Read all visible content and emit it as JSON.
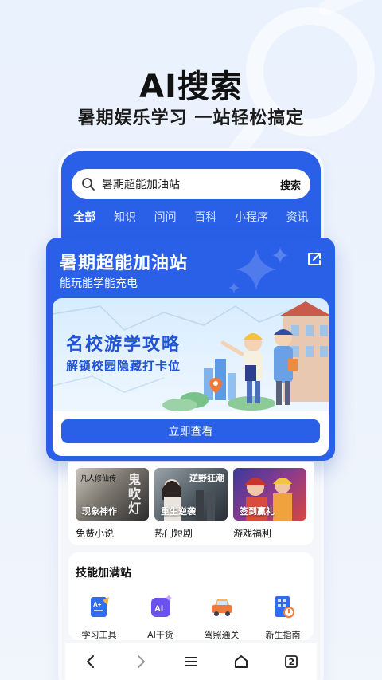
{
  "hero": {
    "title": "AI搜索",
    "subtitle": "暑期娱乐学习 一站轻松搞定"
  },
  "search": {
    "query": "暑期超能加油站",
    "button_label": "搜索",
    "icon": "search-icon"
  },
  "tabs": [
    {
      "label": "全部",
      "active": true
    },
    {
      "label": "知识",
      "active": false
    },
    {
      "label": "问问",
      "active": false
    },
    {
      "label": "百科",
      "active": false
    },
    {
      "label": "小程序",
      "active": false
    },
    {
      "label": "资讯",
      "active": false
    }
  ],
  "promo": {
    "title": "暑期超能加油站",
    "subtitle": "能玩能学能充电",
    "banner_title": "名校游学攻略",
    "banner_subtitle": "解锁校园隐藏打卡位",
    "cta_label": "立即查看",
    "share_icon": "share-icon"
  },
  "media": [
    {
      "tag": "现象神作",
      "label": "免费小说",
      "thumb_text": "鬼吹灯",
      "thumb_text2": "凡人修仙传"
    },
    {
      "tag": "重生逆袭",
      "label": "热门短剧",
      "thumb_text": "逆野狂潮"
    },
    {
      "tag": "签到赢礼",
      "label": "游戏福利"
    }
  ],
  "skills": {
    "title": "技能加满站",
    "items": [
      {
        "label": "学习工具",
        "icon": "study-notebook-icon"
      },
      {
        "label": "AI干货",
        "icon": "ai-badge-icon"
      },
      {
        "label": "驾照通关",
        "icon": "car-icon"
      },
      {
        "label": "新生指南",
        "icon": "building-guide-icon"
      }
    ]
  },
  "nav": {
    "tab_count": "2"
  },
  "colors": {
    "brand_blue": "#2a5fe8",
    "banner_text": "#1f54d6",
    "background": "#eaf2fd"
  }
}
